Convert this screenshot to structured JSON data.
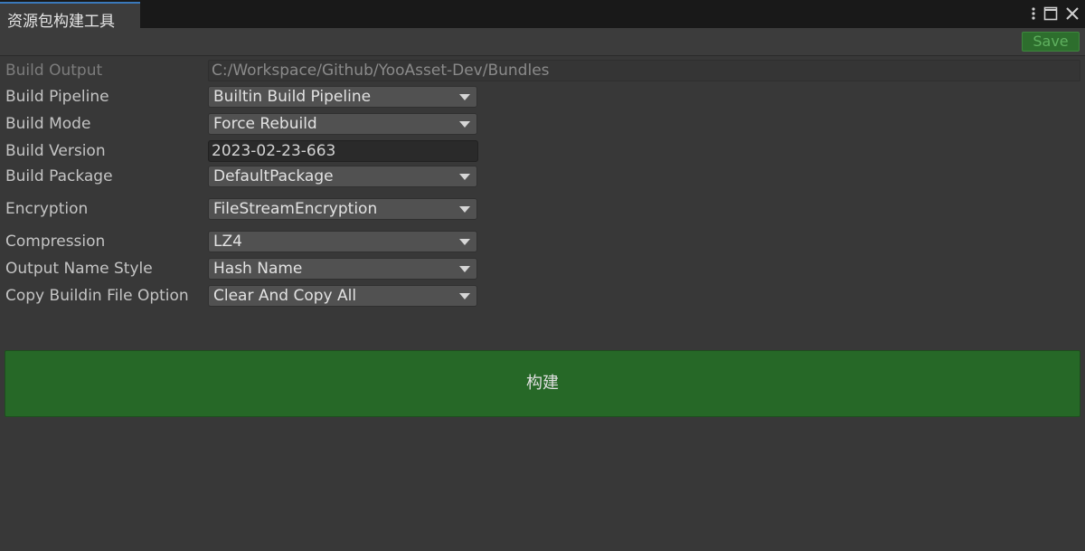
{
  "window": {
    "tab_title": "资源包构建工具"
  },
  "toolbar": {
    "save_label": "Save"
  },
  "form": {
    "build_output": {
      "label": "Build Output",
      "value": "C:/Workspace/Github/YooAsset-Dev/Bundles"
    },
    "build_pipeline": {
      "label": "Build Pipeline",
      "value": "Builtin Build Pipeline"
    },
    "build_mode": {
      "label": "Build Mode",
      "value": "Force Rebuild"
    },
    "build_version": {
      "label": "Build Version",
      "value": "2023-02-23-663"
    },
    "build_package": {
      "label": "Build Package",
      "value": "DefaultPackage"
    },
    "encryption": {
      "label": "Encryption",
      "value": "FileStreamEncryption"
    },
    "compression": {
      "label": "Compression",
      "value": "LZ4"
    },
    "output_name_style": {
      "label": "Output Name Style",
      "value": "Hash Name"
    },
    "copy_buildin_file_option": {
      "label": "Copy Buildin File Option",
      "value": "Clear And Copy All"
    }
  },
  "build_button": {
    "label": "构建"
  },
  "colors": {
    "background": "#383838",
    "tab_accent": "#3a79bb",
    "save_button": "#2d6e2d",
    "build_button": "#266827",
    "dropdown_bg": "#515151"
  },
  "icons": [
    "more-options-icon",
    "maximize-icon",
    "close-icon",
    "dropdown-arrow-icon"
  ]
}
